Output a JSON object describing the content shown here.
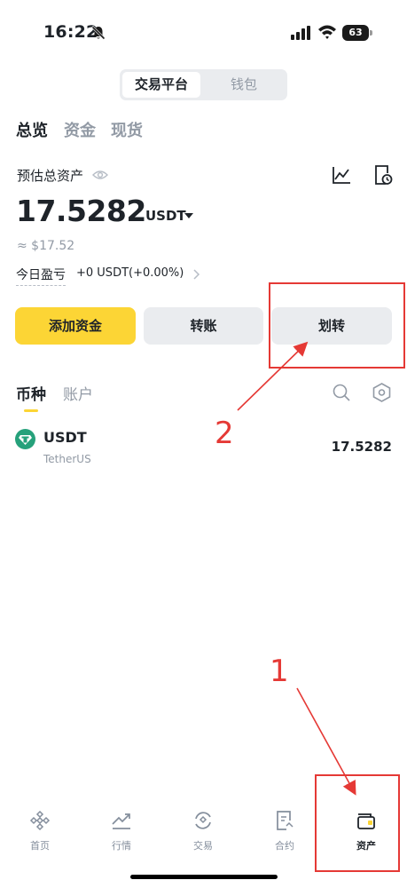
{
  "status_bar": {
    "time": "16:22",
    "battery": "63"
  },
  "segment": {
    "active": "交易平台",
    "inactive": "钱包"
  },
  "top_tabs": [
    "总览",
    "资金",
    "现货"
  ],
  "overview": {
    "estimated_label": "预估总资产",
    "total_value": "17.5282",
    "currency": "USDT",
    "fiat_value": "≈ $17.52",
    "pnl_label": "今日盈亏",
    "pnl_value": "+0 USDT(+0.00%)"
  },
  "actions": {
    "add_funds": "添加资金",
    "transfer": "转账",
    "move": "划转"
  },
  "list_tabs": {
    "coin": "币种",
    "account": "账户"
  },
  "assets": [
    {
      "symbol": "USDT",
      "name": "TetherUS",
      "amount": "17.5282",
      "color": "#26a17b"
    }
  ],
  "bottom_nav": [
    {
      "label": "首页",
      "icon": "home-icon"
    },
    {
      "label": "行情",
      "icon": "markets-icon"
    },
    {
      "label": "交易",
      "icon": "trade-icon"
    },
    {
      "label": "合约",
      "icon": "futures-icon"
    },
    {
      "label": "资产",
      "icon": "wallet-icon",
      "active": true
    }
  ],
  "annotations": {
    "step_1": "1",
    "step_2": "2"
  },
  "colors": {
    "accent": "#fcd535",
    "annotation": "#e53935",
    "text": "#1e2329",
    "muted": "#929aa5"
  }
}
